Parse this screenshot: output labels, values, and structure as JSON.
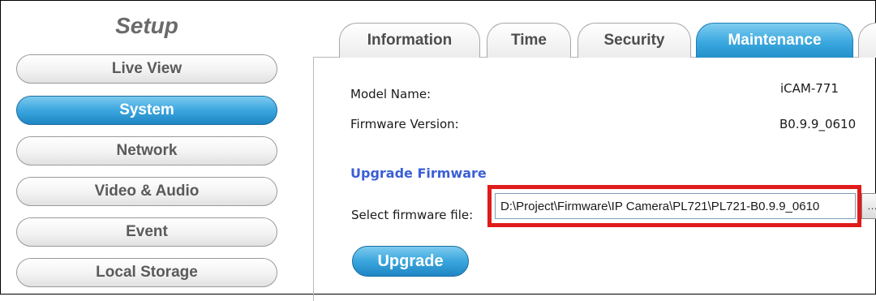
{
  "sidebar": {
    "title": "Setup",
    "items": [
      {
        "label": "Live View"
      },
      {
        "label": "System"
      },
      {
        "label": "Network"
      },
      {
        "label": "Video & Audio"
      },
      {
        "label": "Event"
      },
      {
        "label": "Local Storage"
      }
    ],
    "active_index": 1
  },
  "tabs": [
    {
      "label": "Information"
    },
    {
      "label": "Time"
    },
    {
      "label": "Security"
    },
    {
      "label": "Maintenance"
    }
  ],
  "active_tab": "Maintenance",
  "info": {
    "model_label": "Model Name:",
    "model_value": "iCAM-771",
    "firmware_label": "Firmware Version:",
    "firmware_value": "B0.9.9_0610"
  },
  "upgrade": {
    "section_title": "Upgrade Firmware",
    "select_label": "Select firmware file:",
    "file_value": "D:\\Project\\Firmware\\IP Camera\\PL721\\PL721-B0.9.9_0610",
    "button_label": "Upgrade"
  },
  "colors": {
    "accent_blue": "#3aa6de",
    "section_title": "#3b5fd6",
    "highlight_red": "#e01b1b"
  }
}
